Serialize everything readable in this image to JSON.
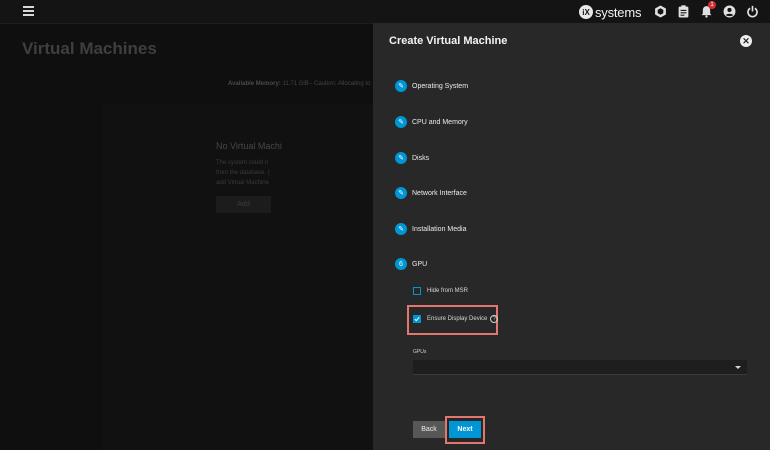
{
  "topbar": {
    "brand_mark": "iX",
    "brand_text": "systems",
    "notification_count": "1",
    "icons": [
      "menu-icon",
      "truecommand-icon",
      "clipboard-icon",
      "bell-icon",
      "account-icon",
      "power-icon"
    ]
  },
  "background_page": {
    "title": "Virtual Machines",
    "memory_label": "Available Memory:",
    "memory_value": "11.71 GiB - Caution: Allocating to",
    "empty_title": "No Virtual Machi",
    "empty_desc_1": "The system could n",
    "empty_desc_2": "from the database. (",
    "empty_desc_3": "add Virtual Machine",
    "empty_button": "Add"
  },
  "panel": {
    "title": "Create Virtual Machine",
    "steps": [
      {
        "label": "Operating System",
        "icon": "pencil-icon"
      },
      {
        "label": "CPU and Memory",
        "icon": "pencil-icon"
      },
      {
        "label": "Disks",
        "icon": "pencil-icon"
      },
      {
        "label": "Network Interface",
        "icon": "pencil-icon"
      },
      {
        "label": "Installation Media",
        "icon": "pencil-icon"
      },
      {
        "label": "GPU",
        "number": "6"
      }
    ],
    "hide_from_msr": {
      "label": "Hide from MSR",
      "checked": false
    },
    "ensure_display_device": {
      "label": "Ensure Display Device",
      "checked": true
    },
    "gpus": {
      "label": "GPUs",
      "value": ""
    },
    "back_label": "Back",
    "next_label": "Next"
  },
  "colors": {
    "accent": "#0095d5",
    "panel_bg": "#282828",
    "highlight": "#e1776f"
  }
}
